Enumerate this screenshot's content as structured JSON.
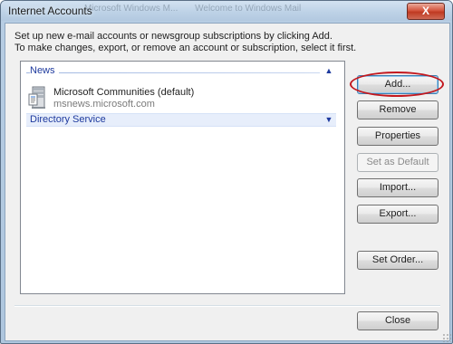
{
  "window": {
    "title": "Internet Accounts",
    "background_tabs": [
      "Microsoft Windows M...",
      "Welcome to Windows Mail"
    ],
    "close_glyph": "X"
  },
  "instructions": {
    "line1": "Set up new e-mail accounts or newsgroup subscriptions by clicking Add.",
    "line2": "To make changes, export, or remove an account or subscription, select it first."
  },
  "accounts_list": {
    "groups": [
      {
        "label": "News",
        "expander": "collapse",
        "accounts": [
          {
            "name": "Microsoft Communities (default)",
            "server": "msnews.microsoft.com",
            "icon": "news-server-icon"
          }
        ]
      },
      {
        "label": "Directory Service",
        "expander": "expand",
        "accounts": []
      }
    ]
  },
  "buttons": {
    "add": "Add...",
    "remove": "Remove",
    "properties": "Properties",
    "set_default": "Set as Default",
    "import": "Import...",
    "export": "Export...",
    "set_order": "Set Order...",
    "close": "Close"
  },
  "colors": {
    "group_header_text": "#1e3a9e",
    "highlight_ring": "#c3181e",
    "disabled_text": "#8b8b8b"
  },
  "annotations": {
    "highlighted_button": "add"
  }
}
